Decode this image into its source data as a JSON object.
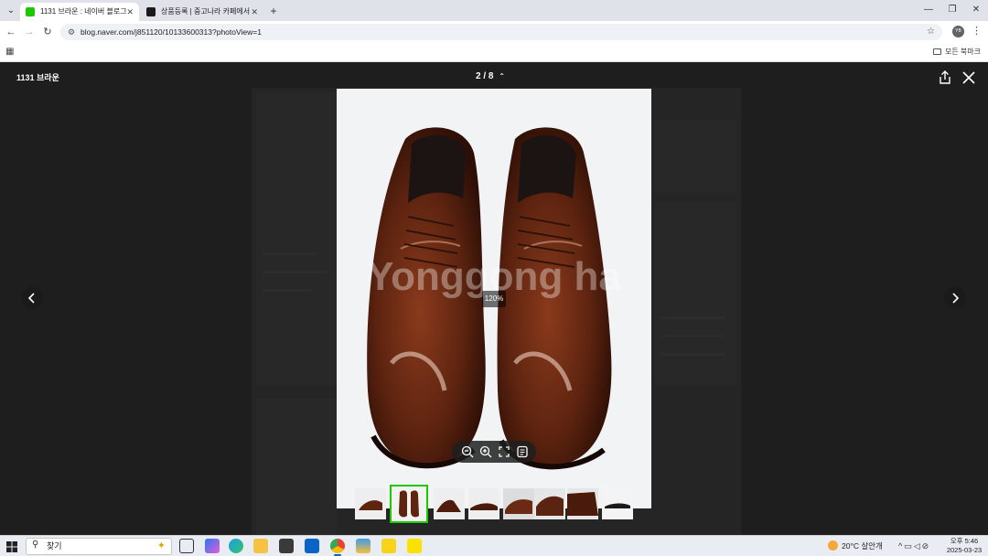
{
  "browser": {
    "tabs": [
      {
        "title": "1131 브라운 : 네이버 블로그",
        "favicon_color": "#1ec800",
        "active": true
      },
      {
        "title": "상품등록 | 중고나라 카페에서",
        "favicon_color": "#1a1a1a",
        "active": false
      }
    ],
    "new_tab_symbol": "+",
    "url": "blog.naver.com/j851120/10133600313?photoView=1",
    "profile_initials": "YB",
    "bookmarks_all": "모든 북마크"
  },
  "viewer": {
    "title": "1131 브라운",
    "counter": "2 / 8",
    "zoom": "120%",
    "watermark": "Yonggong ha",
    "thumbnail_count": 8,
    "selected_thumbnail": 2,
    "icons": {
      "share": "share-icon",
      "close": "close-icon",
      "prev": "chevron-left-icon",
      "next": "chevron-right-icon",
      "zoom_out": "zoom-out-icon",
      "zoom_in": "zoom-in-icon",
      "fullscreen": "fullscreen-icon",
      "list": "list-icon"
    }
  },
  "taskbar": {
    "search_placeholder": "찾기",
    "weather": "20°C 살안개",
    "time": "오후 5:46",
    "date": "2025-03-23"
  },
  "colors": {
    "accent": "#1ec800",
    "shoe": "#6b2a14",
    "viewer_bg": "#2a2a2a"
  }
}
